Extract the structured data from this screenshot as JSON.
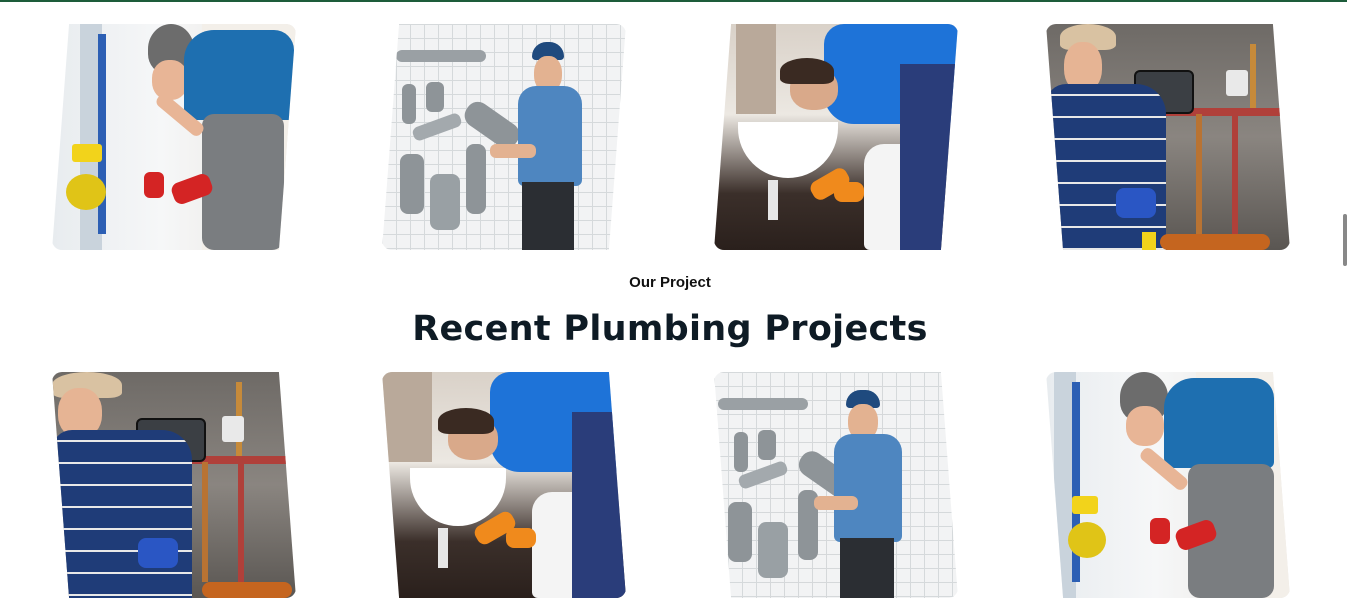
{
  "section": {
    "eyebrow": "Our Project",
    "title": "Recent Plumbing Projects"
  },
  "colors": {
    "top_border": "#1d5c3a",
    "title_color": "#0e1b25",
    "shirt_blue": "#1e6fb0",
    "glove_red": "#d42424",
    "glove_orange": "#f08a1c"
  },
  "projects_top": [
    {
      "id": "p1",
      "scene": "plumber-installing-toilet-pipes"
    },
    {
      "id": "p2",
      "scene": "plumber-holding-pvc-pipe"
    },
    {
      "id": "p3",
      "scene": "plumber-fixing-sink"
    },
    {
      "id": "p4",
      "scene": "plumber-checking-manifold"
    }
  ],
  "projects_bottom": [
    {
      "id": "p5",
      "scene": "plumber-checking-manifold"
    },
    {
      "id": "p6",
      "scene": "plumber-fixing-sink"
    },
    {
      "id": "p7",
      "scene": "plumber-holding-pvc-pipe"
    },
    {
      "id": "p8",
      "scene": "plumber-installing-toilet-pipes"
    }
  ]
}
